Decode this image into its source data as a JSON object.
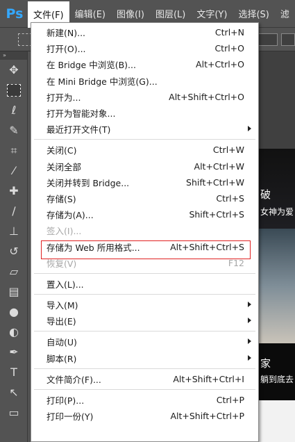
{
  "app": {
    "logo": "Ps"
  },
  "menubar": {
    "items": [
      {
        "label": "文件(F)",
        "active": true
      },
      {
        "label": "编辑(E)",
        "active": false
      },
      {
        "label": "图像(I)",
        "active": false
      },
      {
        "label": "图层(L)",
        "active": false
      },
      {
        "label": "文字(Y)",
        "active": false
      },
      {
        "label": "选择(S)",
        "active": false
      },
      {
        "label": "滤",
        "active": false
      }
    ]
  },
  "toolbar": {
    "collapse_glyph": "»",
    "tools": [
      {
        "name": "move-tool-icon",
        "glyph": "✥"
      },
      {
        "name": "marquee-tool-icon",
        "glyph": ""
      },
      {
        "name": "lasso-tool-icon",
        "glyph": "ℓ"
      },
      {
        "name": "quick-select-tool-icon",
        "glyph": "✎"
      },
      {
        "name": "crop-tool-icon",
        "glyph": "⌗"
      },
      {
        "name": "eyedropper-tool-icon",
        "glyph": "⁄"
      },
      {
        "name": "healing-brush-tool-icon",
        "glyph": "✚"
      },
      {
        "name": "brush-tool-icon",
        "glyph": "∕"
      },
      {
        "name": "clone-stamp-tool-icon",
        "glyph": "⊥"
      },
      {
        "name": "history-brush-tool-icon",
        "glyph": "↺"
      },
      {
        "name": "eraser-tool-icon",
        "glyph": "▱"
      },
      {
        "name": "gradient-tool-icon",
        "glyph": "▤"
      },
      {
        "name": "blur-tool-icon",
        "glyph": "●"
      },
      {
        "name": "dodge-tool-icon",
        "glyph": "◐"
      },
      {
        "name": "pen-tool-icon",
        "glyph": "✒"
      },
      {
        "name": "type-tool-icon",
        "glyph": "T"
      },
      {
        "name": "path-select-tool-icon",
        "glyph": "↖"
      },
      {
        "name": "rectangle-tool-icon",
        "glyph": "▭"
      }
    ]
  },
  "canvas": {
    "texts": [
      {
        "text": "破",
        "cls": ""
      },
      {
        "text": "女神为爱",
        "cls": "small"
      },
      {
        "text": "家",
        "cls": ""
      },
      {
        "text": "躺到底去",
        "cls": "small"
      }
    ]
  },
  "file_menu": {
    "groups": [
      [
        {
          "label": "新建(N)...",
          "shortcut": "Ctrl+N"
        },
        {
          "label": "打开(O)...",
          "shortcut": "Ctrl+O"
        },
        {
          "label": "在 Bridge 中浏览(B)...",
          "shortcut": "Alt+Ctrl+O"
        },
        {
          "label": "在 Mini Bridge 中浏览(G)...",
          "shortcut": ""
        },
        {
          "label": "打开为...",
          "shortcut": "Alt+Shift+Ctrl+O"
        },
        {
          "label": "打开为智能对象...",
          "shortcut": ""
        },
        {
          "label": "最近打开文件(T)",
          "shortcut": "",
          "submenu": true
        }
      ],
      [
        {
          "label": "关闭(C)",
          "shortcut": "Ctrl+W"
        },
        {
          "label": "关闭全部",
          "shortcut": "Alt+Ctrl+W"
        },
        {
          "label": "关闭并转到 Bridge...",
          "shortcut": "Shift+Ctrl+W"
        },
        {
          "label": "存储(S)",
          "shortcut": "Ctrl+S"
        },
        {
          "label": "存储为(A)...",
          "shortcut": "Shift+Ctrl+S"
        },
        {
          "label": "签入(I)...",
          "shortcut": "",
          "disabled": true
        },
        {
          "label": "存储为 Web 所用格式...",
          "shortcut": "Alt+Shift+Ctrl+S",
          "highlighted": true
        },
        {
          "label": "恢复(V)",
          "shortcut": "F12",
          "disabled": true
        }
      ],
      [
        {
          "label": "置入(L)...",
          "shortcut": ""
        }
      ],
      [
        {
          "label": "导入(M)",
          "shortcut": "",
          "submenu": true
        },
        {
          "label": "导出(E)",
          "shortcut": "",
          "submenu": true
        }
      ],
      [
        {
          "label": "自动(U)",
          "shortcut": "",
          "submenu": true
        },
        {
          "label": "脚本(R)",
          "shortcut": "",
          "submenu": true
        }
      ],
      [
        {
          "label": "文件简介(F)...",
          "shortcut": "Alt+Shift+Ctrl+I"
        }
      ],
      [
        {
          "label": "打印(P)...",
          "shortcut": "Ctrl+P"
        },
        {
          "label": "打印一份(Y)",
          "shortcut": "Alt+Shift+Ctrl+P"
        }
      ]
    ]
  },
  "colors": {
    "ui_bg": "#535353",
    "menu_bg": "#ffffff",
    "highlight_border": "#e02020",
    "logo": "#34a8ff"
  }
}
